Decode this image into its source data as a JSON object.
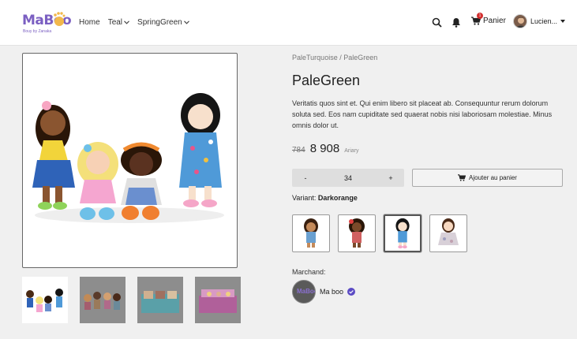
{
  "brand": {
    "name": "MaBoo",
    "tagline": "Bouy by Zanaka"
  },
  "nav": {
    "items": [
      {
        "label": "Home",
        "has_dropdown": false
      },
      {
        "label": "Teal",
        "has_dropdown": true
      },
      {
        "label": "SpringGreen",
        "has_dropdown": true
      }
    ]
  },
  "header": {
    "cart_label": "Panier",
    "cart_count": "1",
    "user_name": "Lucien..."
  },
  "breadcrumb": "PaleTurquoise / PaleGreen",
  "product": {
    "title": "PaleGreen",
    "description": "Veritatis quos sint et. Qui enim libero sit placeat ab. Consequuntur rerum dolorum soluta sed. Eos nam cupiditate sed quaerat nobis nisi laboriosam molestiae. Minus omnis dolor ut.",
    "price_old": "784",
    "price_new": "8 908",
    "currency": "Ariary",
    "quantity": "34",
    "qty_minus": "-",
    "qty_plus": "+",
    "add_to_cart": "Ajouter au panier",
    "variant_label": "Variant:",
    "variant_value": "Darkorange",
    "selected_variant_index": 2
  },
  "merchant": {
    "label": "Marchand:",
    "name": "Ma boo",
    "avatar_text": "MaBoo"
  },
  "colors": {
    "brand": "#7b5fc2",
    "badge": "#d32f2f",
    "verified": "#5b4bc4"
  },
  "icons": {
    "search": "search-icon",
    "bell": "bell-icon",
    "cart": "cart-icon",
    "verified": "check-badge-icon"
  }
}
